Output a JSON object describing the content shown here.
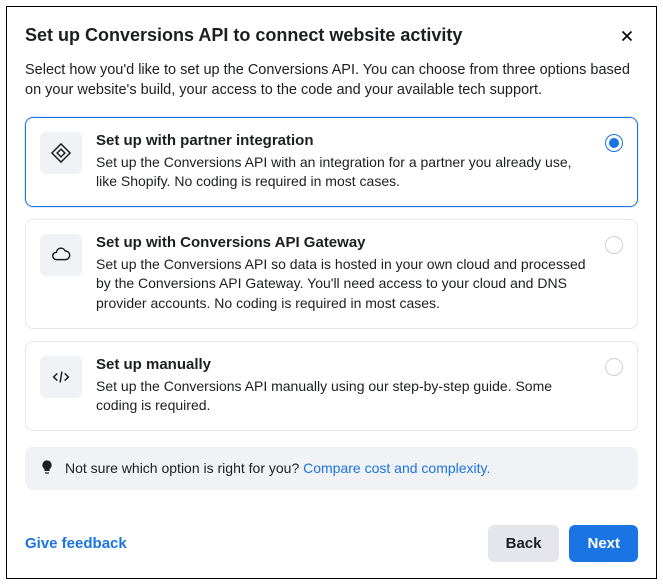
{
  "header": {
    "title": "Set up Conversions API to connect website activity",
    "subtitle": "Select how you'd like to set up the Conversions API. You can choose from three options based on your website's build, your access to the code and your available tech support."
  },
  "options": [
    {
      "title": "Set up with partner integration",
      "desc": "Set up the Conversions API with an integration for a partner you already use, like Shopify. No coding is required in most cases."
    },
    {
      "title": "Set up with Conversions API Gateway",
      "desc": "Set up the Conversions API so data is hosted in your own cloud and processed by the Conversions API Gateway. You'll need access to your cloud and DNS provider accounts. No coding is required in most cases."
    },
    {
      "title": "Set up manually",
      "desc": "Set up the Conversions API manually using our step-by-step guide. Some coding is required."
    }
  ],
  "hint": {
    "text": "Not sure which option is right for you? ",
    "link": "Compare cost and complexity."
  },
  "footer": {
    "feedback": "Give feedback",
    "back": "Back",
    "next": "Next"
  }
}
